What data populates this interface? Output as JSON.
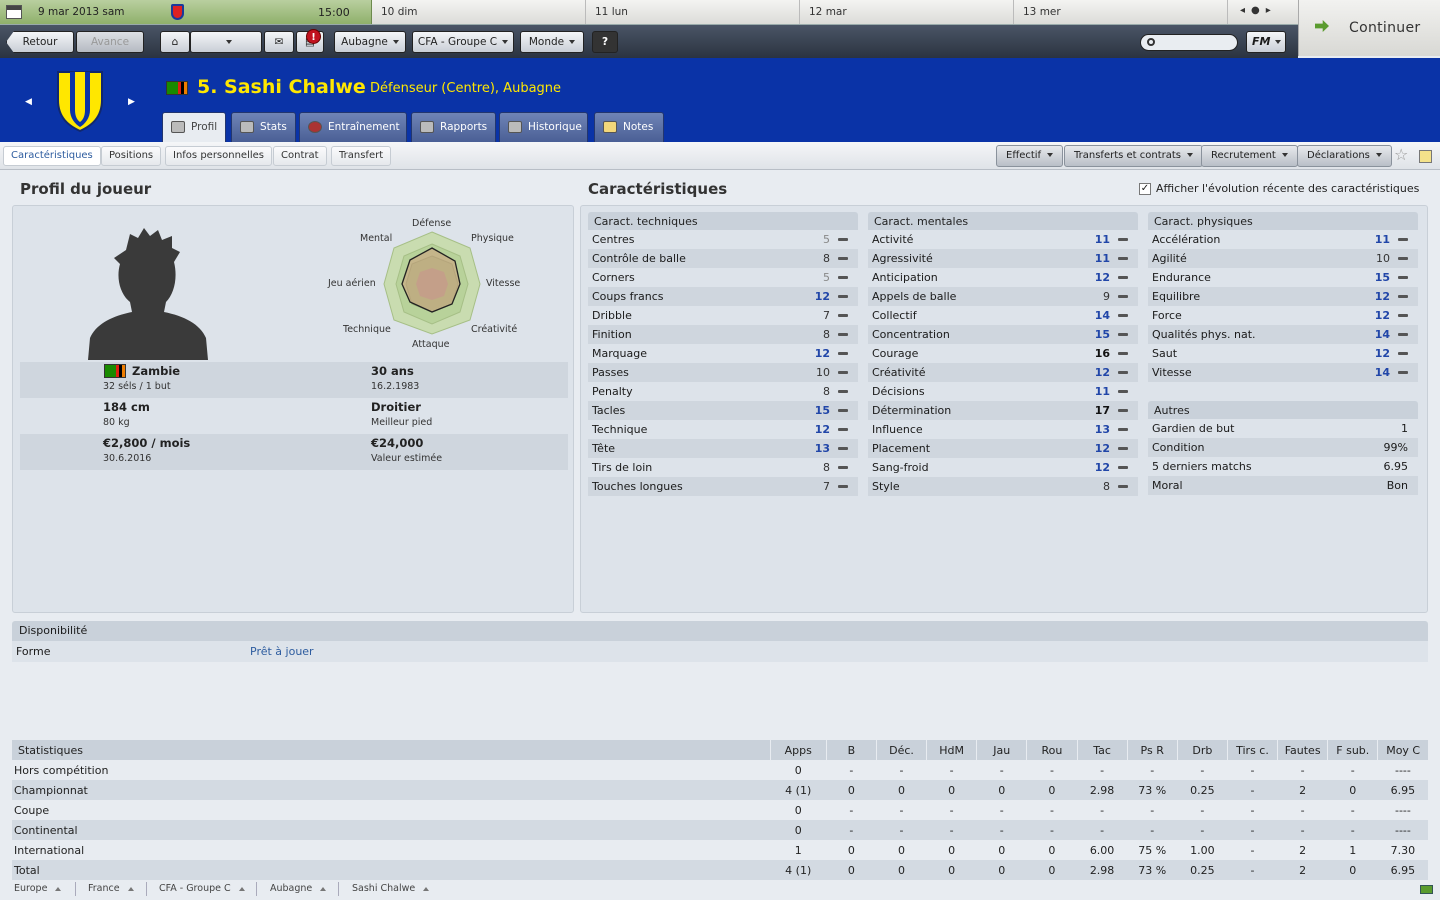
{
  "topbar": {
    "date": "9 mar 2013  sam",
    "time": "15:00",
    "days": [
      "10  dim",
      "11  lun",
      "12  mar",
      "13  mer"
    ],
    "continue": "Continuer"
  },
  "toolbar": {
    "back": "Retour",
    "forward": "Avance",
    "club_menu": "Aubagne",
    "league_menu": "CFA - Groupe C",
    "world_menu": "Monde",
    "help": "?",
    "badge": "!",
    "fm": "FM"
  },
  "player": {
    "name": "5. Sashi Chalwe",
    "role": "Défenseur (Centre), Aubagne"
  },
  "tabs": [
    "Profil",
    "Stats",
    "Entraînement",
    "Rapports",
    "Historique",
    "Notes"
  ],
  "subnav": [
    "Caractéristiques",
    "Positions",
    "Infos personnelles",
    "Contrat",
    "Transfert"
  ],
  "dropdowns": [
    "Effectif",
    "Transferts et contrats",
    "Recrutement",
    "Déclarations"
  ],
  "profile": {
    "title": "Profil du joueur",
    "radar": [
      "Défense",
      "Physique",
      "Vitesse",
      "Créativité",
      "Attaque",
      "Technique",
      "Jeu aérien",
      "Mental"
    ],
    "nationality": "Zambie",
    "caps": "32 séls / 1 but",
    "age": "30 ans",
    "dob": "16.2.1983",
    "height": "184 cm",
    "weight": "80 kg",
    "foot": "Droitier",
    "foot_label": "Meilleur pied",
    "wage": "€2,800 / mois",
    "contract_end": "30.6.2016",
    "value": "€24,000",
    "value_label": "Valeur estimée"
  },
  "attributes": {
    "title": "Caractéristiques",
    "show_evolution": "Afficher l'évolution récente des caractéristiques",
    "technical_title": "Caract. techniques",
    "technical": [
      [
        "Centres",
        5
      ],
      [
        "Contrôle de balle",
        8
      ],
      [
        "Corners",
        5
      ],
      [
        "Coups francs",
        12
      ],
      [
        "Dribble",
        7
      ],
      [
        "Finition",
        8
      ],
      [
        "Marquage",
        12
      ],
      [
        "Passes",
        10
      ],
      [
        "Penalty",
        8
      ],
      [
        "Tacles",
        15
      ],
      [
        "Technique",
        12
      ],
      [
        "Tête",
        13
      ],
      [
        "Tirs de loin",
        8
      ],
      [
        "Touches longues",
        7
      ]
    ],
    "mental_title": "Caract. mentales",
    "mental": [
      [
        "Activité",
        11
      ],
      [
        "Agressivité",
        11
      ],
      [
        "Anticipation",
        12
      ],
      [
        "Appels de balle",
        9
      ],
      [
        "Collectif",
        14
      ],
      [
        "Concentration",
        15
      ],
      [
        "Courage",
        16
      ],
      [
        "Créativité",
        12
      ],
      [
        "Décisions",
        11
      ],
      [
        "Détermination",
        17
      ],
      [
        "Influence",
        13
      ],
      [
        "Placement",
        12
      ],
      [
        "Sang-froid",
        12
      ],
      [
        "Style",
        8
      ]
    ],
    "physical_title": "Caract. physiques",
    "physical": [
      [
        "Accélération",
        11
      ],
      [
        "Agilité",
        10
      ],
      [
        "Endurance",
        15
      ],
      [
        "Equilibre",
        12
      ],
      [
        "Force",
        12
      ],
      [
        "Qualités phys. nat.",
        14
      ],
      [
        "Saut",
        12
      ],
      [
        "Vitesse",
        14
      ]
    ],
    "other_title": "Autres",
    "other": [
      [
        "Gardien de but",
        "1"
      ],
      [
        "Condition",
        "99%"
      ],
      [
        "5 derniers matchs",
        "6.95"
      ],
      [
        "Moral",
        "Bon"
      ]
    ]
  },
  "availability": {
    "title": "Disponibilité",
    "label": "Forme",
    "value": "Prêt à jouer"
  },
  "stats": {
    "headers": [
      "Statistiques",
      "Apps",
      "B",
      "Déc.",
      "HdM",
      "Jau",
      "Rou",
      "Tac",
      "Ps R",
      "Drb",
      "Tirs c.",
      "Fautes",
      "F sub.",
      "Moy C"
    ],
    "rows": [
      [
        "Hors compétition",
        "0",
        "-",
        "-",
        "-",
        "-",
        "-",
        "-",
        "-",
        "-",
        "-",
        "-",
        "-",
        "----"
      ],
      [
        "Championnat",
        "4 (1)",
        "0",
        "0",
        "0",
        "0",
        "0",
        "2.98",
        "73 %",
        "0.25",
        "-",
        "2",
        "0",
        "6.95"
      ],
      [
        "Coupe",
        "0",
        "-",
        "-",
        "-",
        "-",
        "-",
        "-",
        "-",
        "-",
        "-",
        "-",
        "-",
        "----"
      ],
      [
        "Continental",
        "0",
        "-",
        "-",
        "-",
        "-",
        "-",
        "-",
        "-",
        "-",
        "-",
        "-",
        "-",
        "----"
      ],
      [
        "International",
        "1",
        "0",
        "0",
        "0",
        "0",
        "0",
        "6.00",
        "75 %",
        "1.00",
        "-",
        "2",
        "1",
        "7.30"
      ],
      [
        "Total",
        "4 (1)",
        "0",
        "0",
        "0",
        "0",
        "0",
        "2.98",
        "73 %",
        "0.25",
        "-",
        "2",
        "0",
        "6.95"
      ]
    ]
  },
  "breadcrumb": [
    "Europe",
    "France",
    "CFA - Groupe C",
    "Aubagne",
    "Sashi Chalwe"
  ],
  "colors": {
    "header_bg": "#0a33a7",
    "name_yellow": "#ffe700",
    "high_attr": "#2146a8"
  }
}
